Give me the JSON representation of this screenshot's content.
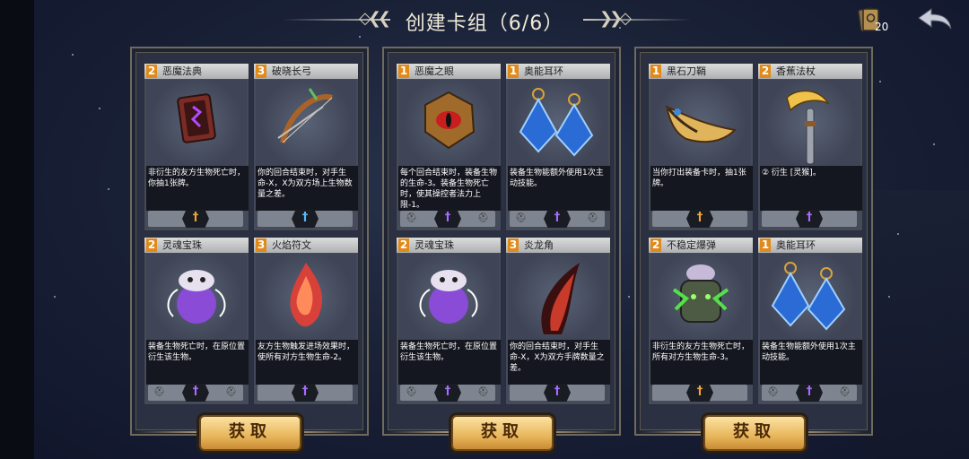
{
  "header": {
    "title": "创建卡组（6/6）",
    "deck_count": "20"
  },
  "colors": {
    "cost_badge": "#e08a1a",
    "button_gold": "#e8b65c",
    "text_light": "#f1ead8"
  },
  "panels": [
    {
      "button_label": "获取",
      "cards": [
        {
          "cost": "2",
          "name": "恶魔法典",
          "desc": "非衍生的友方生物死亡时，你抽1张牌。",
          "symbol": "†",
          "symbol_color": "#f2a533",
          "art": "book-icon",
          "sides": false
        },
        {
          "cost": "3",
          "name": "破晓长弓",
          "desc": "你的回合结束时，对手生命-X，X为双方场上生物数量之差。",
          "symbol": "†",
          "symbol_color": "#59b8ff",
          "art": "bow-icon",
          "sides": false
        },
        {
          "cost": "2",
          "name": "灵魂宝珠",
          "desc": "装备生物死亡时，在原位置衍生该生物。",
          "symbol": "†",
          "symbol_color": "#a66bff",
          "art": "orb-icon",
          "sides": true
        },
        {
          "cost": "3",
          "name": "火焰符文",
          "desc": "友方生物触发进场效果时，使所有对方生物生命-2。",
          "symbol": "†",
          "symbol_color": "#a66bff",
          "art": "rune-icon",
          "sides": false
        }
      ]
    },
    {
      "button_label": "获取",
      "cards": [
        {
          "cost": "1",
          "name": "恶魔之眼",
          "desc": "每个回合结束时，装备生物的生命-3。装备生物死亡时，使其操控者法力上限-1。",
          "symbol": "†",
          "symbol_color": "#a66bff",
          "art": "eye-icon",
          "sides": true
        },
        {
          "cost": "1",
          "name": "奥能耳环",
          "desc": "装备生物能额外使用1次主动技能。",
          "symbol": "†",
          "symbol_color": "#a66bff",
          "art": "earring-icon",
          "sides": true
        },
        {
          "cost": "2",
          "name": "灵魂宝珠",
          "desc": "装备生物死亡时，在原位置衍生该生物。",
          "symbol": "†",
          "symbol_color": "#a66bff",
          "art": "orb-icon",
          "sides": true
        },
        {
          "cost": "3",
          "name": "炎龙角",
          "desc": "你的回合结束时，对手生命-X，X为双方手牌数量之差。",
          "symbol": "†",
          "symbol_color": "#a66bff",
          "art": "horn-icon",
          "sides": false
        }
      ]
    },
    {
      "button_label": "获取",
      "cards": [
        {
          "cost": "1",
          "name": "黑石刀鞘",
          "desc": "当你打出装备卡时，抽1张牌。",
          "symbol": "†",
          "symbol_color": "#f2a533",
          "art": "scabbard-icon",
          "sides": false
        },
        {
          "cost": "2",
          "name": "香蕉法杖",
          "desc": "② 衍生 [灵猴]。",
          "symbol": "†",
          "symbol_color": "#a66bff",
          "art": "staff-icon",
          "sides": false
        },
        {
          "cost": "2",
          "name": "不稳定爆弹",
          "desc": "非衍生的友方生物死亡时，所有对方生物生命-3。",
          "symbol": "†",
          "symbol_color": "#f2a533",
          "art": "bomb-icon",
          "sides": false
        },
        {
          "cost": "1",
          "name": "奥能耳环",
          "desc": "装备生物能额外使用1次主动技能。",
          "symbol": "†",
          "symbol_color": "#a66bff",
          "art": "earring-icon",
          "sides": true
        }
      ]
    }
  ]
}
